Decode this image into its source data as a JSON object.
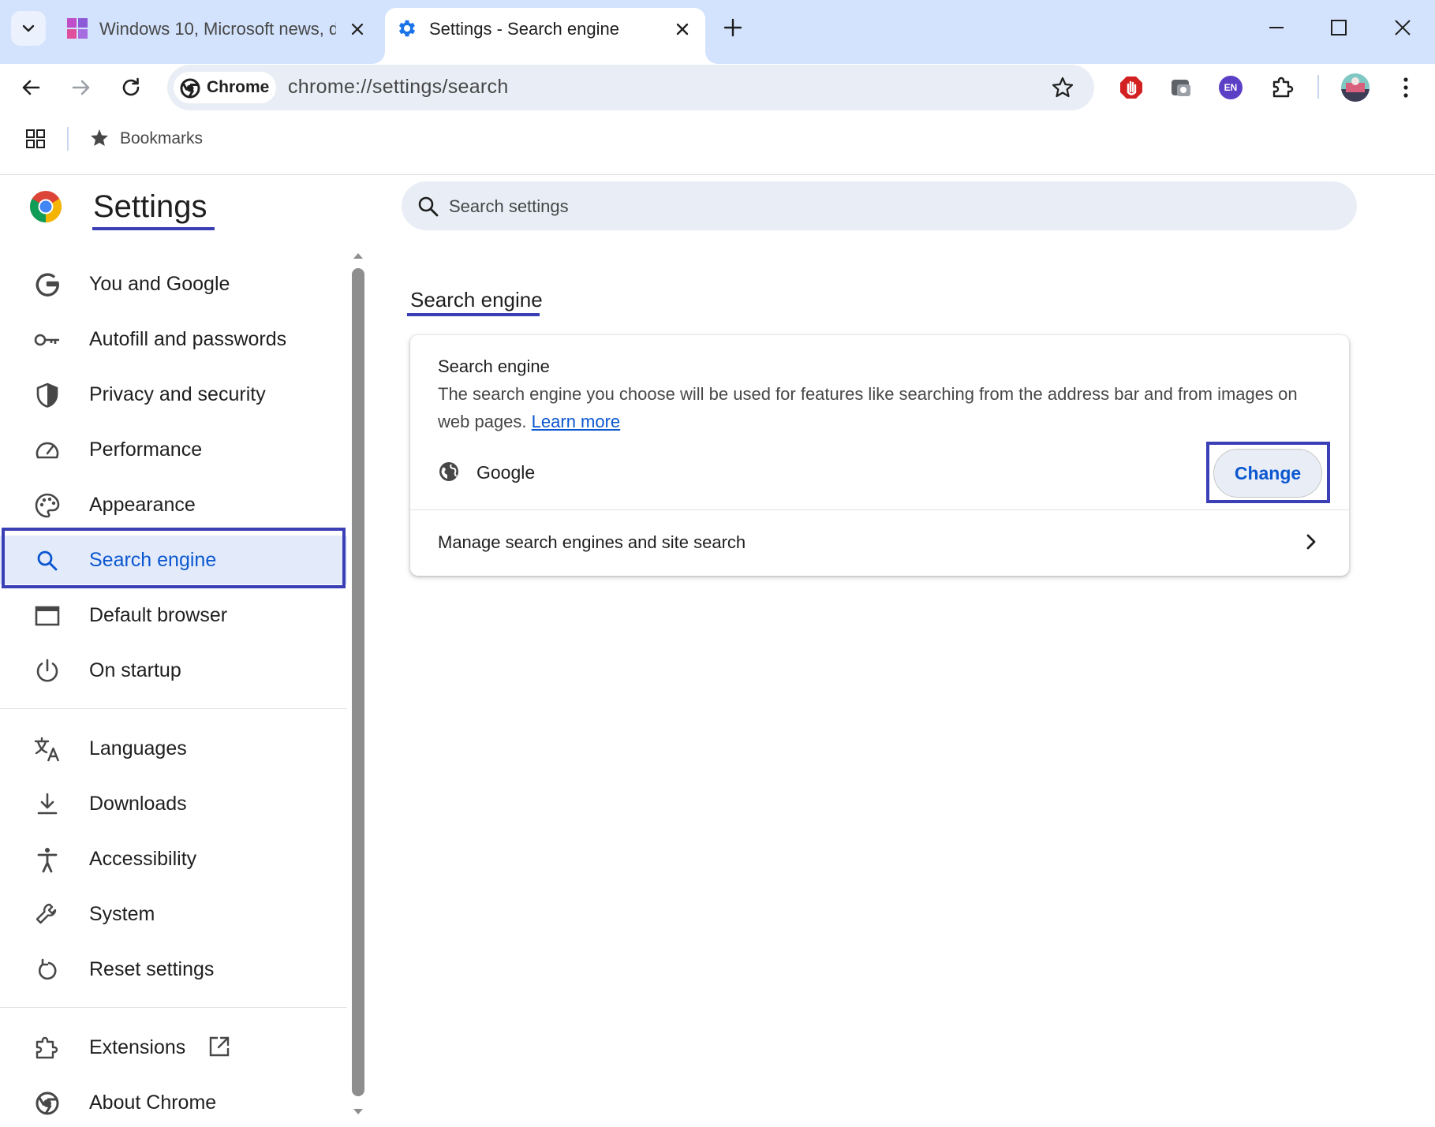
{
  "window": {
    "tabs": [
      {
        "title": "Windows 10, Microsoft news, d",
        "icon": "windows-tile-icon",
        "active": false
      },
      {
        "title": "Settings - Search engine",
        "icon": "gear-icon",
        "active": true
      }
    ]
  },
  "toolbar": {
    "chip_label": "Chrome",
    "url": "chrome://settings/search",
    "extension_badge": "EN"
  },
  "bookmarks_bar": {
    "label": "Bookmarks"
  },
  "settings": {
    "title": "Settings",
    "search_placeholder": "Search settings",
    "nav": {
      "you_and_google": "You and Google",
      "autofill": "Autofill and passwords",
      "privacy": "Privacy and security",
      "performance": "Performance",
      "appearance": "Appearance",
      "search_engine": "Search engine",
      "default_browser": "Default browser",
      "on_startup": "On startup",
      "languages": "Languages",
      "downloads": "Downloads",
      "accessibility": "Accessibility",
      "system": "System",
      "reset": "Reset settings",
      "extensions": "Extensions",
      "about": "About Chrome"
    },
    "active_nav": "Search engine"
  },
  "main": {
    "section_title": "Search engine",
    "card": {
      "heading": "Search engine",
      "description_line1": "The search engine you choose will be used for features like searching from the address bar and from images on",
      "description_line2": "web pages.",
      "learn_more": "Learn more",
      "current_engine": "Google",
      "change_label": "Change",
      "manage_label": "Manage search engines and site search"
    }
  },
  "colors": {
    "tabstrip": "#d3e3fd",
    "accent": "#0b57d0",
    "annotation": "#3b3fb6",
    "active_nav_bg": "#e3ebfb"
  }
}
